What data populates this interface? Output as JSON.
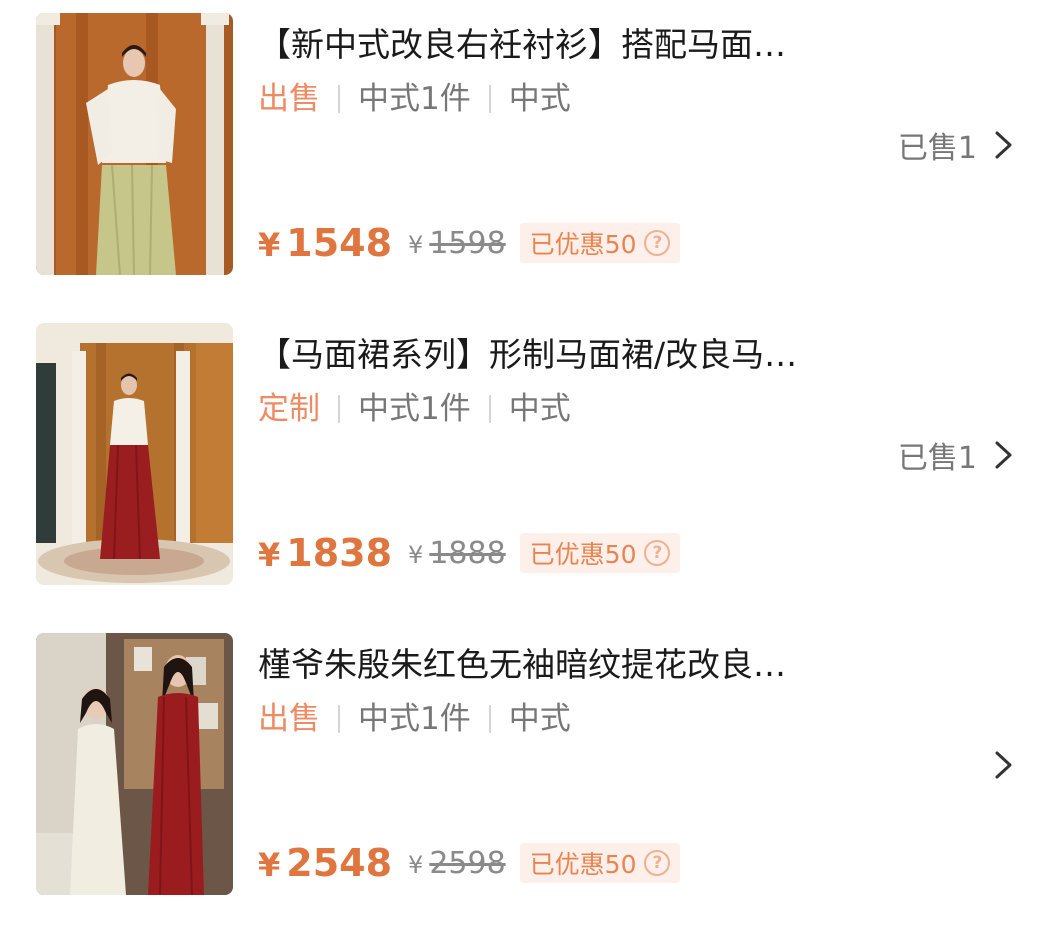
{
  "products": [
    {
      "title": "【新中式改良右衽衬衫】搭配马面…",
      "type": "出售",
      "category": "中式1件",
      "style": "中式",
      "sold": "已售1",
      "currency": "¥",
      "price": "1548",
      "original_price": "1598",
      "discount": "已优惠50",
      "image": "woman-white-blouse-green-skirt"
    },
    {
      "title": "【马面裙系列】形制马面裙/改良马…",
      "type": "定制",
      "category": "中式1件",
      "style": "中式",
      "sold": "已售1",
      "currency": "¥",
      "price": "1838",
      "original_price": "1888",
      "discount": "已优惠50",
      "image": "woman-white-blouse-red-skirt"
    },
    {
      "title": "槿爷朱殷朱红色无袖暗纹提花改良…",
      "type": "出售",
      "category": "中式1件",
      "style": "中式",
      "sold": "",
      "currency": "¥",
      "price": "2548",
      "original_price": "2598",
      "discount": "已优惠50",
      "image": "two-women-qipao-white-red"
    }
  ],
  "colors": {
    "accent": "#e0763f",
    "type_tag": "#ee8b63",
    "discount_bg": "#fdf0ea"
  },
  "icons": {
    "chevron": "chevron-right-icon",
    "help": "question-circle-icon"
  }
}
